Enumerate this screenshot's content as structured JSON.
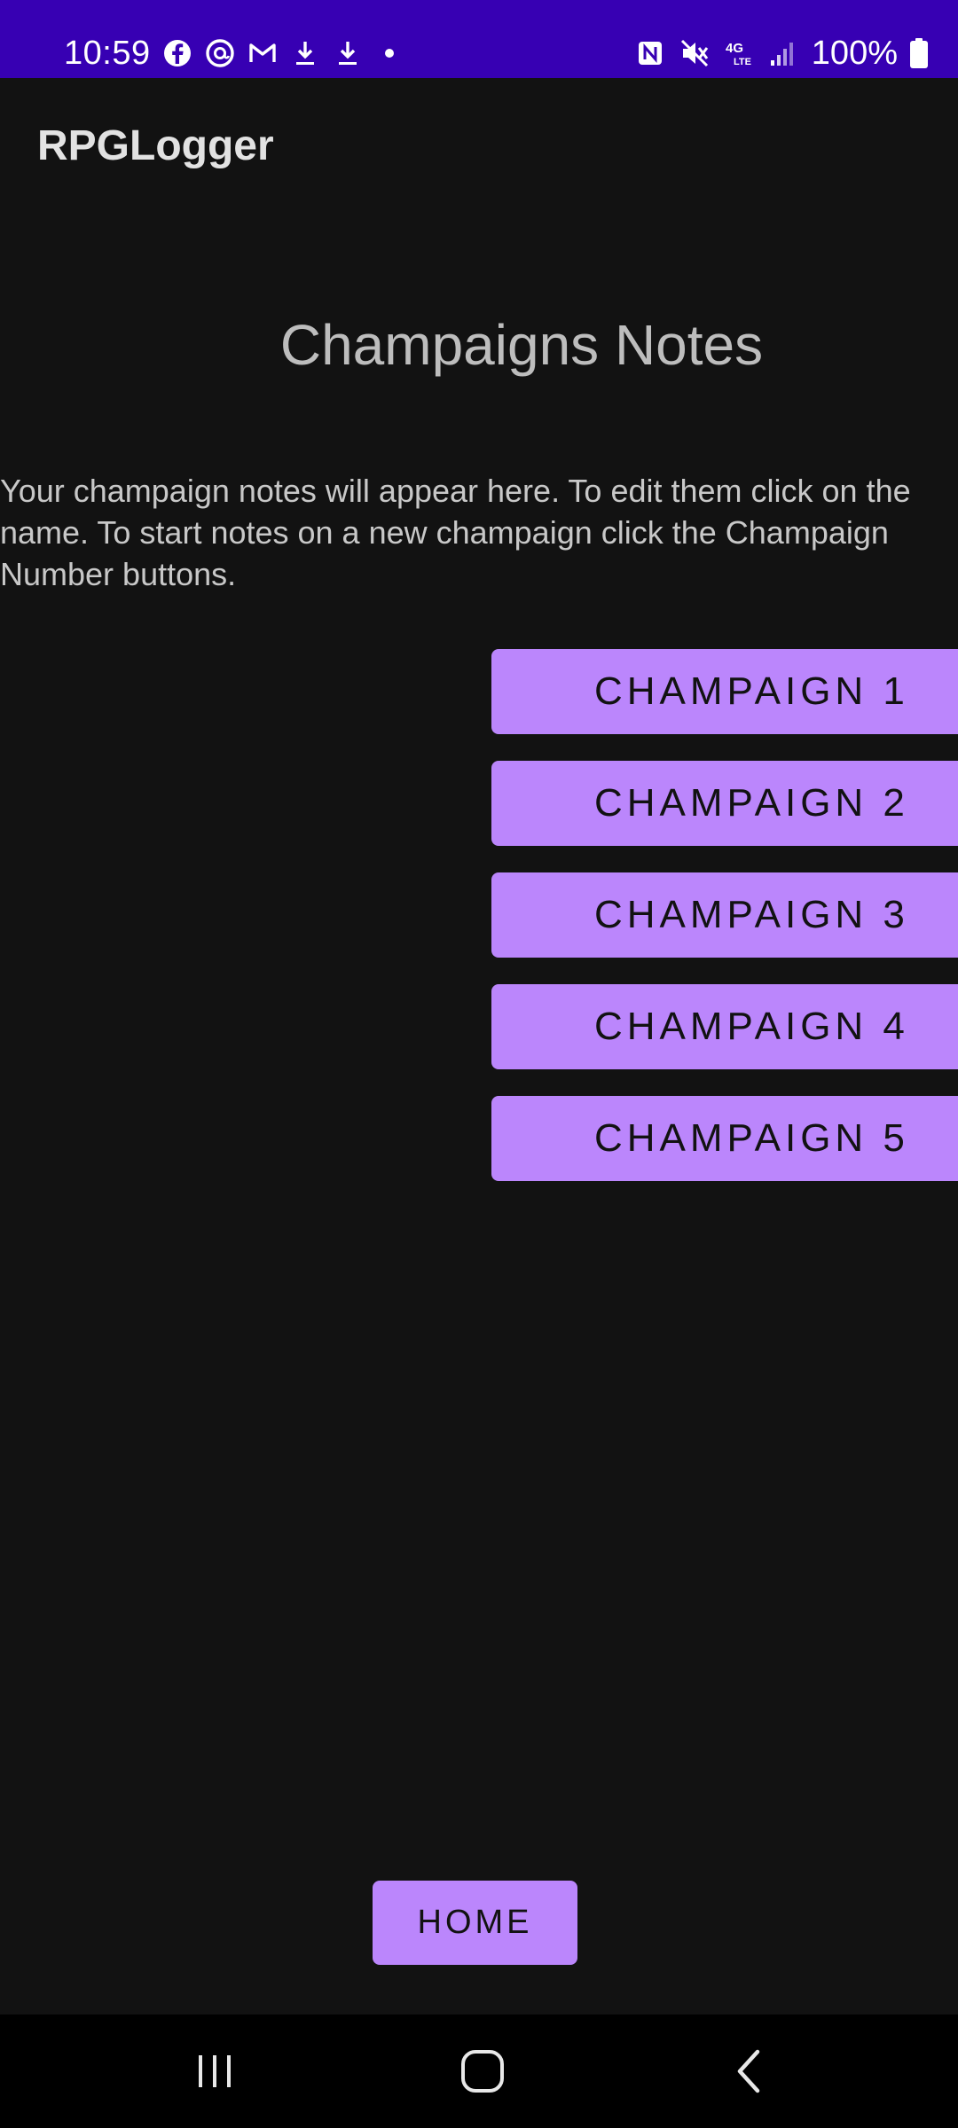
{
  "status_bar": {
    "time": "10:59",
    "battery_percent": "100%",
    "background_color": "#3700B3",
    "left_icons": [
      "facebook-icon",
      "threads-icon",
      "gmail-icon",
      "download-icon",
      "download-icon",
      "dot-icon"
    ],
    "right_icons": [
      "nfc-icon",
      "mute-icon",
      "4g-lte-icon",
      "signal-icon",
      "battery-icon"
    ]
  },
  "app_bar": {
    "title": "RPGLogger"
  },
  "main": {
    "heading": "Champaigns Notes",
    "description": "Your champaign notes will appear here. To edit them click on the name. To start notes on a new champaign click the Champaign Number buttons.",
    "buttons": [
      {
        "label": "CHAMPAIGN 1"
      },
      {
        "label": "CHAMPAIGN 2"
      },
      {
        "label": "CHAMPAIGN 3"
      },
      {
        "label": "CHAMPAIGN 4"
      },
      {
        "label": "CHAMPAIGN 5"
      }
    ],
    "home_button": "HOME"
  },
  "nav_bar": {
    "icons": [
      "recent-apps-icon",
      "home-icon",
      "back-icon"
    ]
  },
  "colors": {
    "background": "#121212",
    "accent": "#BB86FC",
    "status_bar": "#3700B3"
  }
}
